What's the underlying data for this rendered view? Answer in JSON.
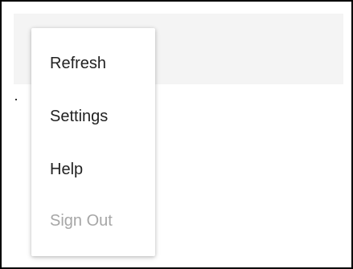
{
  "menu": {
    "items": [
      {
        "label": "Refresh",
        "enabled": true
      },
      {
        "label": "Settings",
        "enabled": true
      },
      {
        "label": "Help",
        "enabled": true
      },
      {
        "label": "Sign Out",
        "enabled": false
      }
    ]
  },
  "colors": {
    "toolbar_background": "#f4f4f4",
    "menu_text": "#222222",
    "disabled_text": "#a6a6a6",
    "border": "#000000"
  }
}
